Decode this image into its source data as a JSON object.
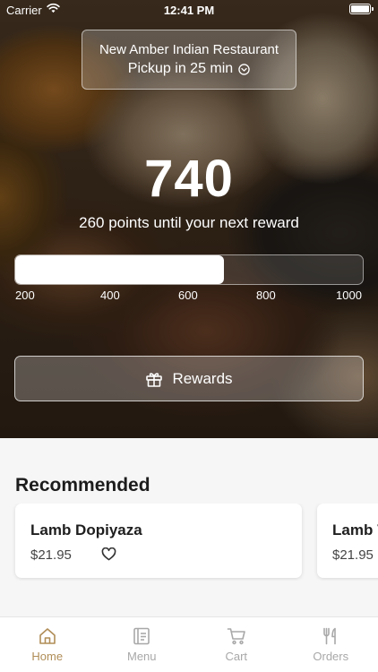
{
  "status_bar": {
    "carrier": "Carrier",
    "time": "12:41 PM"
  },
  "store": {
    "name": "New Amber Indian Restaurant",
    "pickup": "Pickup in 25 min"
  },
  "points": {
    "value": "740",
    "until_text": "260 points until your next reward",
    "progress_value": 740,
    "scale_max": 1000
  },
  "progress_ticks": [
    "200",
    "400",
    "600",
    "800",
    "1000"
  ],
  "rewards_button": {
    "label": "Rewards"
  },
  "recommended": {
    "title": "Recommended",
    "items": [
      {
        "name": "Lamb Dopiyaza",
        "price": "$21.95"
      },
      {
        "name": "Lamb V",
        "price": "$21.95"
      }
    ]
  },
  "tabs": [
    {
      "label": "Home",
      "icon": "home-icon",
      "active": true
    },
    {
      "label": "Menu",
      "icon": "menu-icon",
      "active": false
    },
    {
      "label": "Cart",
      "icon": "cart-icon",
      "active": false
    },
    {
      "label": "Orders",
      "icon": "fork-knife-icon",
      "active": false
    }
  ],
  "colors": {
    "accent": "#b08d57",
    "inactive_tab": "#a8a8a8"
  }
}
